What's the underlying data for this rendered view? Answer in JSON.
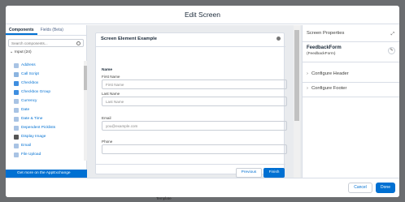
{
  "modal": {
    "title": "Edit Screen"
  },
  "left_panel": {
    "tabs": [
      "Components",
      "Fields (Beta)"
    ],
    "search_placeholder": "Search components...",
    "group": "Input (24)",
    "items": [
      {
        "label": "Address",
        "icon": "address-icon",
        "color": "#a8c3e4"
      },
      {
        "label": "Call Script",
        "icon": "call-script-icon",
        "color": "#8bb4e0"
      },
      {
        "label": "Checkbox",
        "icon": "checkbox-icon",
        "color": "#3e8ee0"
      },
      {
        "label": "Checkbox Group",
        "icon": "checkbox-group-icon",
        "color": "#3e8ee0"
      },
      {
        "label": "Currency",
        "icon": "currency-icon",
        "color": "#a8c3e4"
      },
      {
        "label": "Date",
        "icon": "date-icon",
        "color": "#a8c3e4"
      },
      {
        "label": "Date & Time",
        "icon": "date-time-icon",
        "color": "#a8c3e4"
      },
      {
        "label": "Dependent Picklists",
        "icon": "dependent-picklists-icon",
        "color": "#a8c3e4"
      },
      {
        "label": "Display Image",
        "icon": "display-image-icon",
        "color": "#555555"
      },
      {
        "label": "Email",
        "icon": "email-icon",
        "color": "#a8c3e4"
      },
      {
        "label": "File Upload",
        "icon": "file-upload-icon",
        "color": "#a8c3e4"
      }
    ],
    "appexchange": "Get more on the AppExchange"
  },
  "canvas": {
    "title": "Screen Element Example",
    "section": "Name",
    "fields": [
      {
        "label": "First Name",
        "placeholder": "First Name"
      },
      {
        "label": "Last Name",
        "placeholder": "Last Name"
      },
      {
        "label": "Email",
        "placeholder": "you@example.com"
      },
      {
        "label": "Phone",
        "placeholder": ""
      }
    ],
    "previous": "Previous",
    "finish": "Finish"
  },
  "right_panel": {
    "title": "Screen Properties",
    "name": "FeedbackForm",
    "api_name": "(FeedbackForm)",
    "sections": [
      "Configure Header",
      "Configure Footer"
    ]
  },
  "footer": {
    "cancel": "Cancel",
    "done": "Done"
  },
  "background_text": "Template",
  "colors": {
    "brand": "#0070d2"
  }
}
